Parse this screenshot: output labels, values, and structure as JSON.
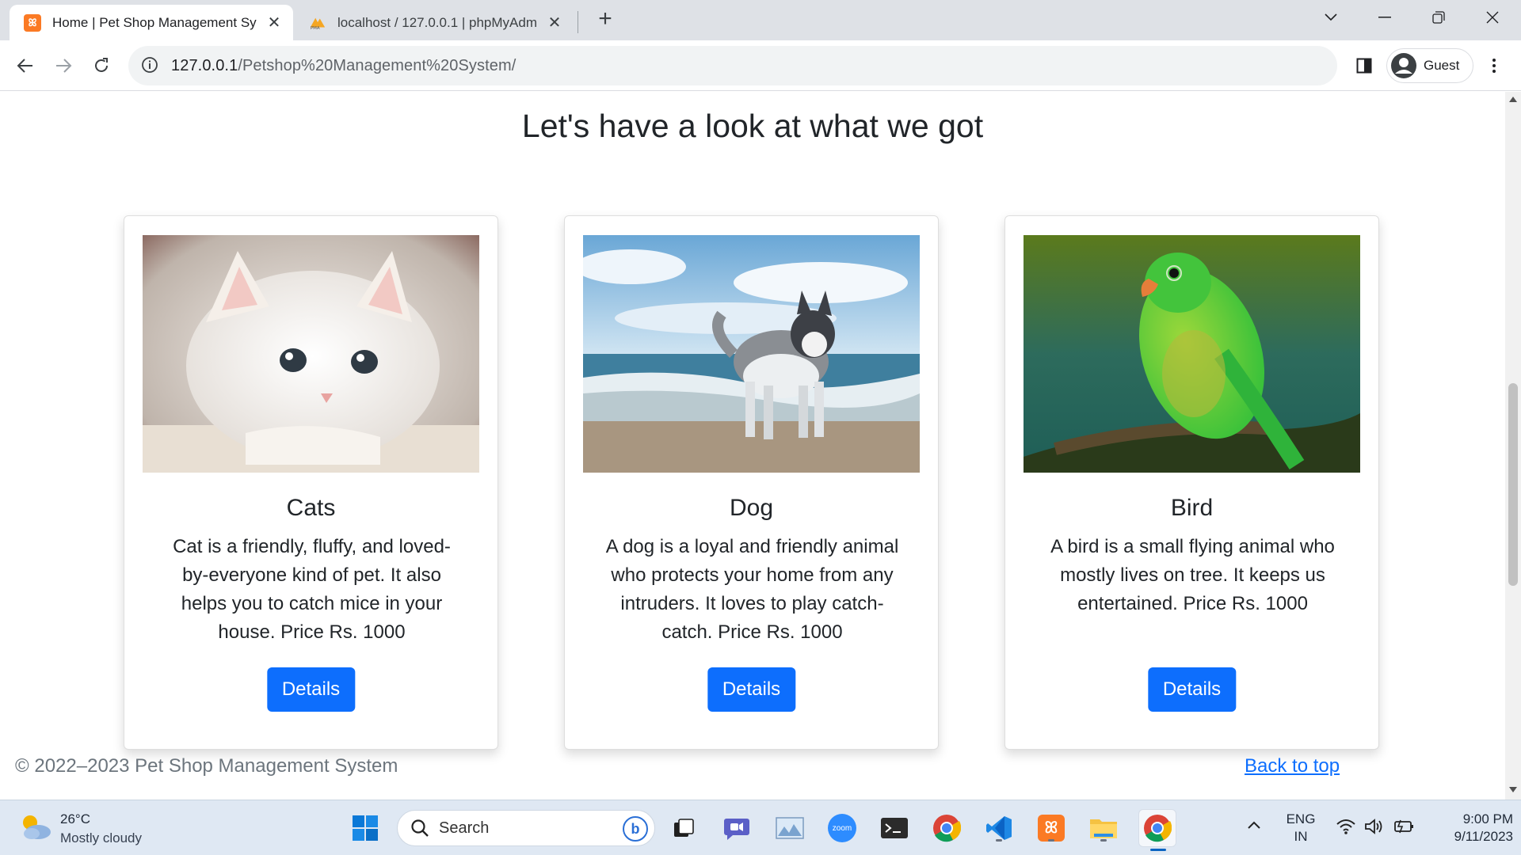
{
  "browser": {
    "tabs": [
      {
        "title": "Home | Pet Shop Management Sy",
        "active": true
      },
      {
        "title": "localhost / 127.0.0.1 | phpMyAdm",
        "active": false
      }
    ],
    "url_host": "127.0.0.1",
    "url_path": "/Petshop%20Management%20System/",
    "profile_label": "Guest"
  },
  "page": {
    "heading": "Let's have a look at what we got",
    "cards": [
      {
        "title": "Cats",
        "text": "Cat is a friendly, fluffy, and loved-by-everyone kind of pet. It also helps you to catch mice in your house. Price Rs. 1000",
        "button": "Details"
      },
      {
        "title": "Dog",
        "text": "A dog is a loyal and friendly animal who protects your home from any intruders. It loves to play catch-catch. Price Rs. 1000",
        "button": "Details"
      },
      {
        "title": "Bird",
        "text": "A bird is a small flying animal who mostly lives on tree. It keeps us entertained. Price Rs. 1000",
        "button": "Details"
      }
    ],
    "footer_copyright": "© 2022–2023 Pet Shop Management System",
    "back_to_top": "Back to top"
  },
  "taskbar": {
    "weather_temp": "26°C",
    "weather_desc": "Mostly cloudy",
    "search_placeholder": "Search",
    "lang_line1": "ENG",
    "lang_line2": "IN",
    "time": "9:00 PM",
    "date": "9/11/2023",
    "zoom_label": "zoom"
  },
  "colors": {
    "primary": "#0d6efd",
    "tabbar": "#dee1e6",
    "taskbar": "#dfe8f3"
  }
}
